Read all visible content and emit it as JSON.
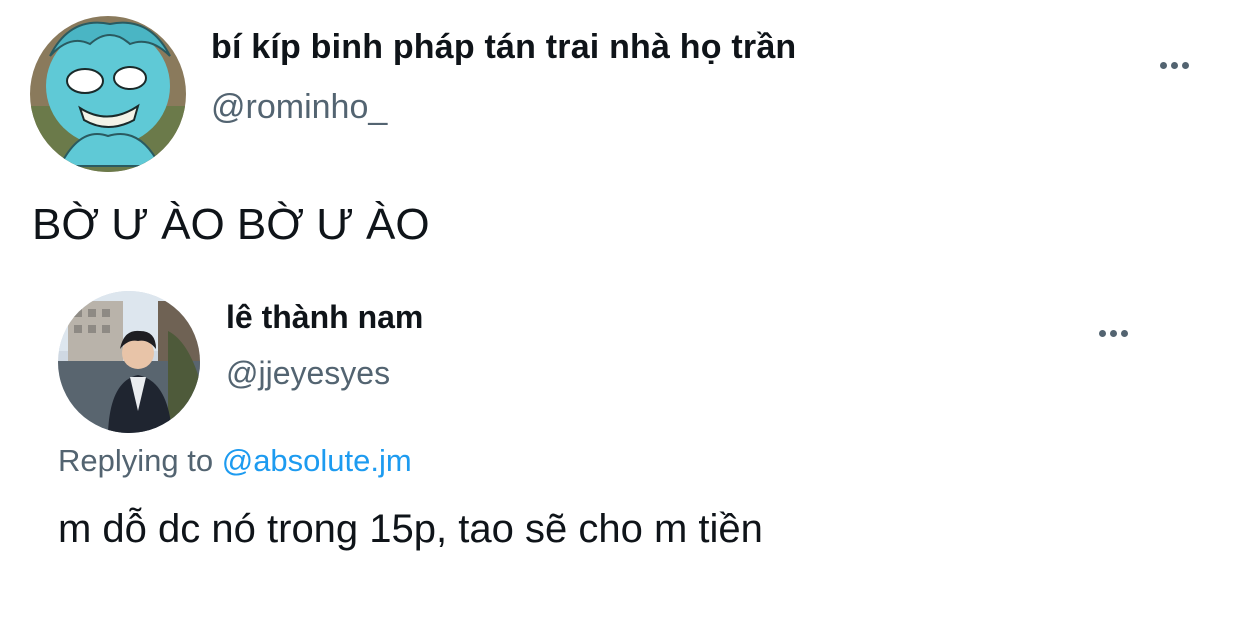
{
  "tweet": {
    "author": {
      "display_name": "bí kíp binh pháp tán trai nhà họ trần",
      "handle": "@rominho_",
      "avatar_icon": "cartoon-avatar-icon"
    },
    "text": "BỜ Ư ÀO BỜ Ư ÀO",
    "more_icon": "more-options-icon"
  },
  "quoted_tweet": {
    "author": {
      "display_name": "lê thành nam",
      "handle": "@jjeyesyes",
      "avatar_icon": "photo-avatar-icon"
    },
    "replying_label": "Replying to",
    "replying_to": "@absolute.jm",
    "text": "m dỗ dc nó trong 15p, tao sẽ cho m tiền",
    "more_icon": "more-options-icon"
  },
  "colors": {
    "text_primary": "#0f1419",
    "text_secondary": "#536471",
    "link": "#1d9bf0",
    "background": "#ffffff"
  }
}
